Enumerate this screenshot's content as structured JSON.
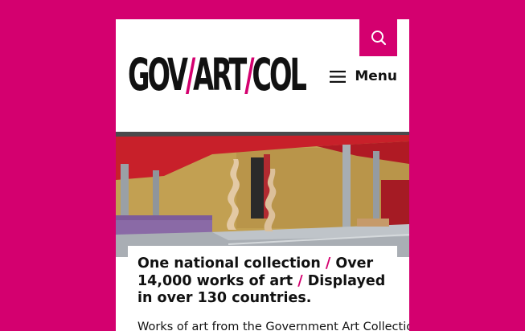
{
  "header": {
    "logo": {
      "part1": "GOV",
      "sep1": "/",
      "part2": "ART",
      "sep2": "/",
      "part3": "COL"
    },
    "search_icon": "search-icon",
    "menu_icon": "hamburger-icon",
    "menu_label": "Menu"
  },
  "hero": {
    "alt": "Gallery interior with two spiralling sculptures"
  },
  "card": {
    "headline": {
      "line1": "One national collection",
      "sep1": "/",
      "line2": "Over 14,000 works of art",
      "sep2": "/",
      "line3": "Displayed in over 130 countries."
    },
    "intro": "Works of art from the Government Art Collection"
  },
  "colors": {
    "brand": "#d4006f",
    "text": "#111111",
    "background": "#ffffff"
  }
}
